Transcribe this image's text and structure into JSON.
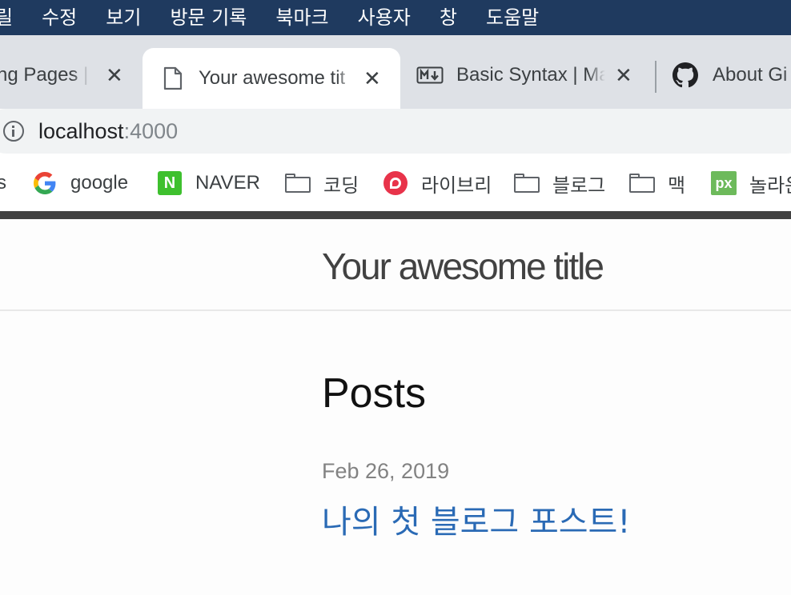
{
  "menubar": {
    "items": [
      "릴",
      "수정",
      "보기",
      "방문 기록",
      "북마크",
      "사용자",
      "창",
      "도움말"
    ]
  },
  "tabs": [
    {
      "title": "ng Pages |",
      "close": "✕",
      "icon": "none",
      "active": false
    },
    {
      "title": "Your awesome tit",
      "close": "✕",
      "icon": "file-icon",
      "active": true
    },
    {
      "title": "Basic Syntax | Ma",
      "close": "✕",
      "icon": "markdown-icon",
      "active": false
    },
    {
      "title": "About Gi",
      "icon": "github-icon",
      "active": false
    }
  ],
  "omnibox": {
    "host": "localhost",
    "port": ":4000"
  },
  "bookmarks": [
    {
      "label": "s",
      "icon": "none"
    },
    {
      "label": "google",
      "icon": "google-icon"
    },
    {
      "label": "NAVER",
      "icon": "naver-icon"
    },
    {
      "label": "코딩",
      "icon": "folder-icon"
    },
    {
      "label": "라이브리",
      "icon": "ridi-icon"
    },
    {
      "label": "블로그",
      "icon": "folder-icon"
    },
    {
      "label": "맥",
      "icon": "folder-icon"
    },
    {
      "label": "놀라운",
      "icon": "px-icon"
    }
  ],
  "page": {
    "site_title": "Your awesome title",
    "heading": "Posts",
    "posts": [
      {
        "date": "Feb 26, 2019",
        "title": "나의 첫 블로그 포스트!"
      }
    ]
  },
  "colors": {
    "menubar": "#1f3a5f",
    "link": "#2a6ab5",
    "tabstrip": "#dee1e6"
  }
}
